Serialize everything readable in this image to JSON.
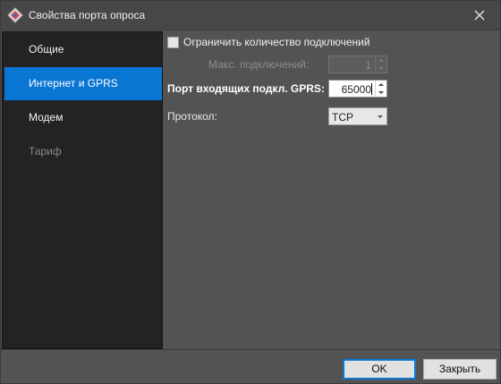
{
  "window": {
    "title": "Свойства порта опроса",
    "icon": "app-diamond-icon",
    "accent_color": "#0a76d4"
  },
  "sidebar": {
    "items": [
      {
        "label": "Общие",
        "state": "normal"
      },
      {
        "label": "Интернет и GPRS",
        "state": "selected"
      },
      {
        "label": "Модем",
        "state": "normal"
      },
      {
        "label": "Тариф",
        "state": "disabled"
      }
    ]
  },
  "form": {
    "limit_checkbox": {
      "label": "Ограничить количество подключений",
      "checked": false
    },
    "max_connections": {
      "label": "Макс. подключений:",
      "value": "1",
      "enabled": false
    },
    "incoming_port": {
      "label": "Порт входящих подкл. GPRS:",
      "value": "65000"
    },
    "protocol": {
      "label": "Протокол:",
      "value": "TCP"
    }
  },
  "buttons": {
    "ok": "OK",
    "close": "Закрыть"
  }
}
